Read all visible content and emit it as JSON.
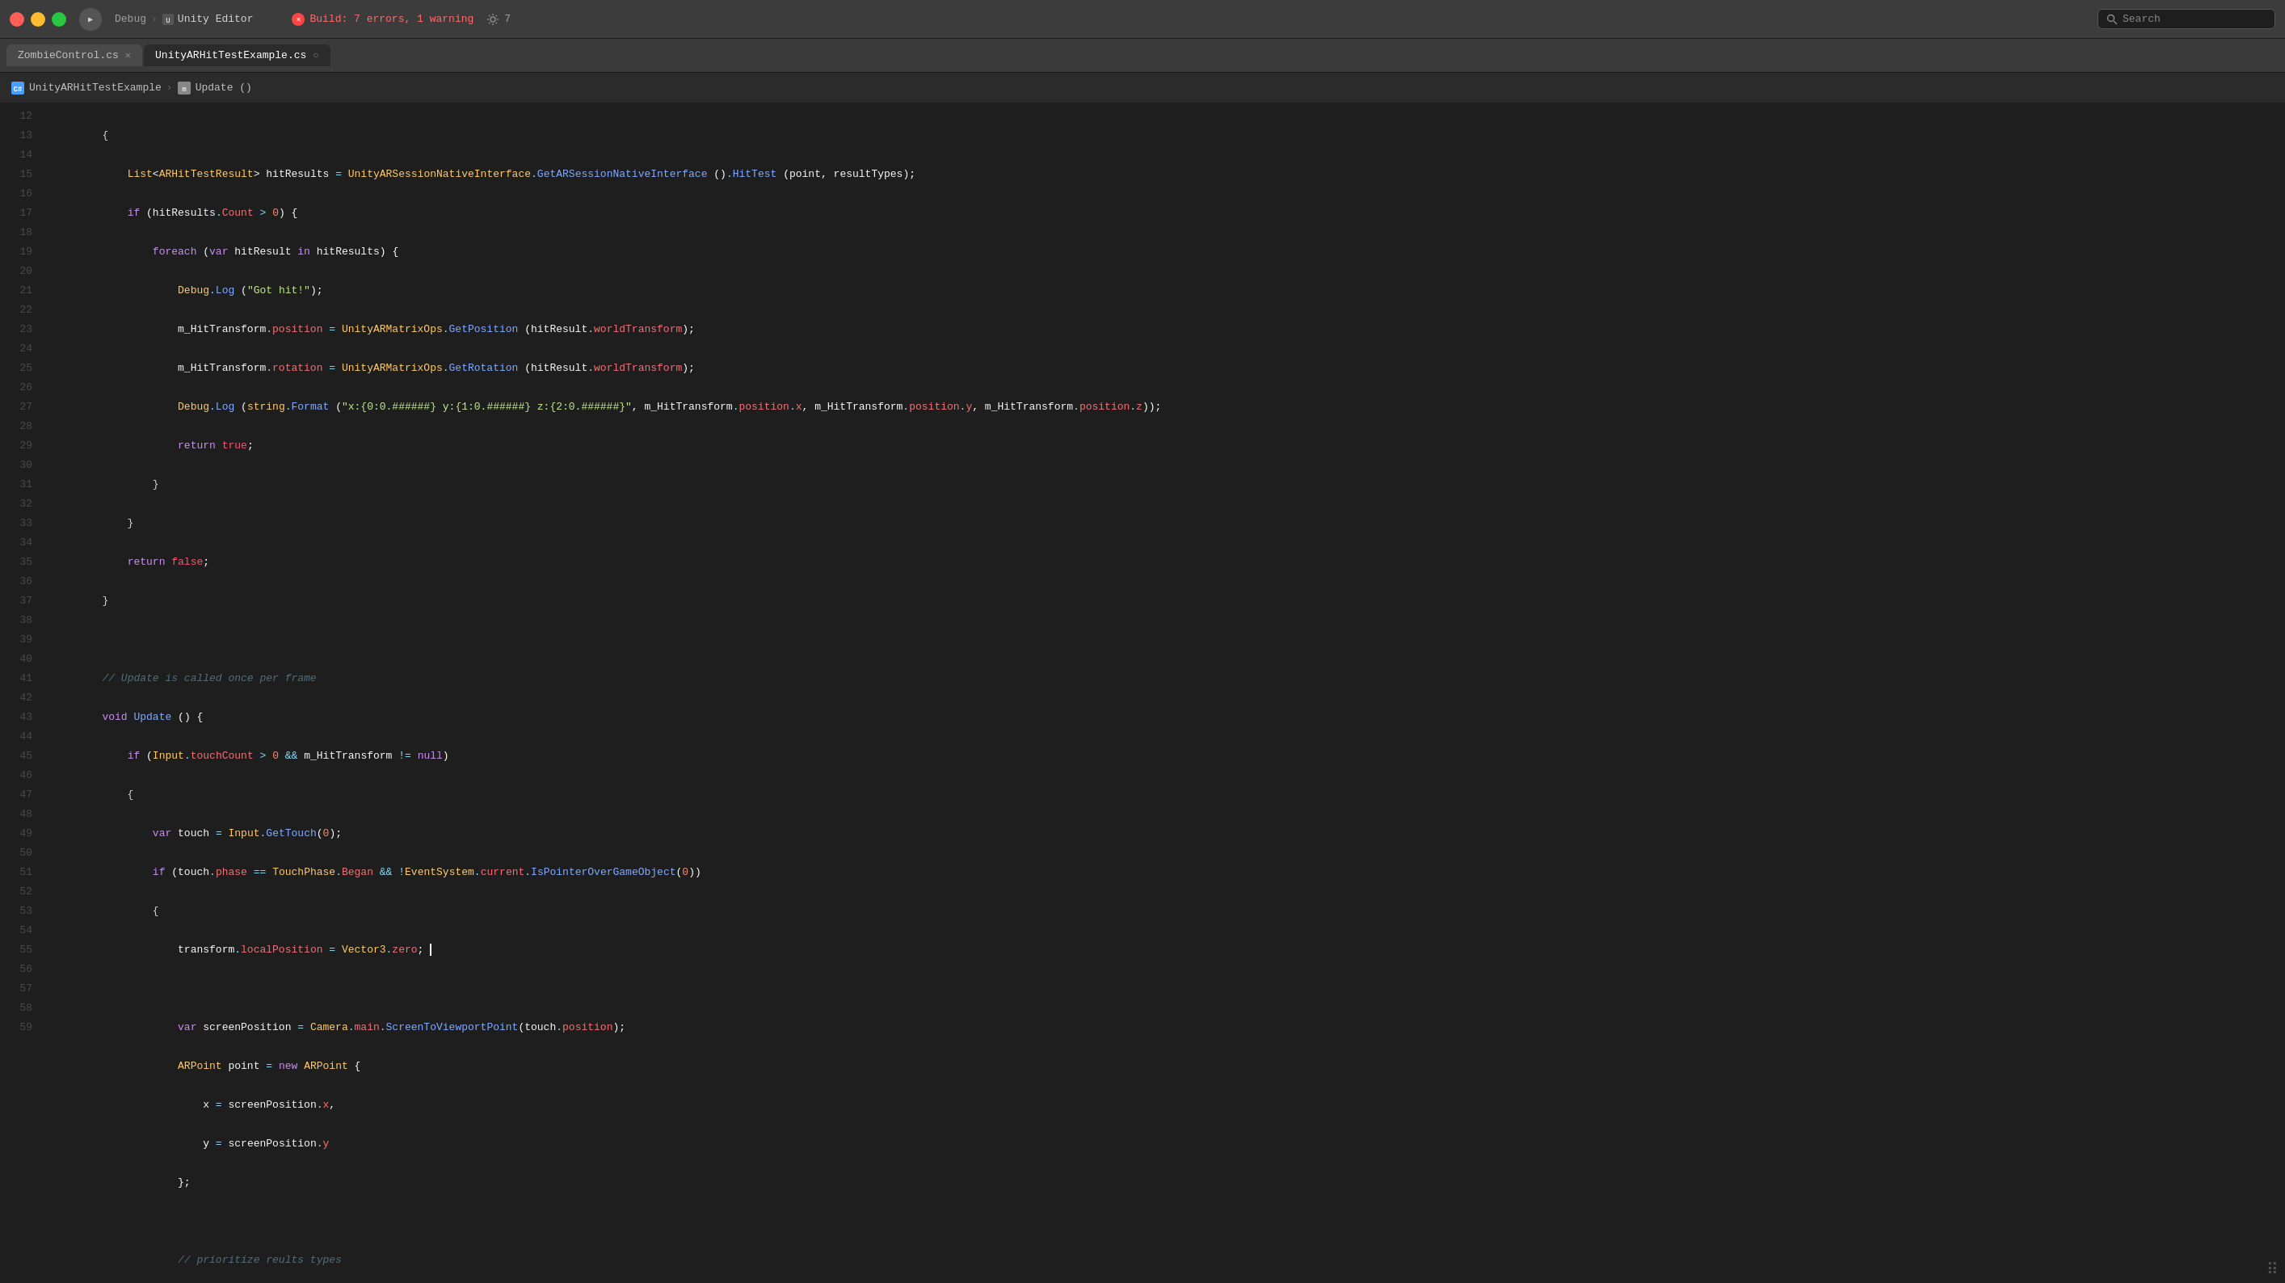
{
  "titlebar": {
    "nav": {
      "debug_label": "Debug",
      "separator": ">",
      "unity_editor_label": "Unity Editor"
    },
    "build_status": {
      "text": "Build: 7 errors, 1 warning",
      "count": "7"
    },
    "search_placeholder": "Search"
  },
  "tabs": [
    {
      "label": "ZombieControl.cs",
      "active": false
    },
    {
      "label": "UnityARHitTestExample.cs",
      "active": true
    }
  ],
  "breadcrumb": {
    "class": "UnityARHitTestExample",
    "method": "Update ()"
  },
  "lines": [
    {
      "num": "12",
      "indent": 2,
      "content": "{"
    },
    {
      "num": "13",
      "indent": 3
    },
    {
      "num": "14",
      "indent": 3
    },
    {
      "num": "15",
      "indent": 4
    },
    {
      "num": "16",
      "indent": 5
    },
    {
      "num": "17",
      "indent": 5
    },
    {
      "num": "18",
      "indent": 5
    },
    {
      "num": "19",
      "indent": 5
    },
    {
      "num": "20",
      "indent": 5
    },
    {
      "num": "21",
      "indent": 4,
      "content": "}"
    },
    {
      "num": "22",
      "indent": 3
    },
    {
      "num": "23",
      "indent": 3
    },
    {
      "num": "24",
      "indent": 2,
      "content": "}"
    },
    {
      "num": "25",
      "indent": 0,
      "content": ""
    },
    {
      "num": "26",
      "indent": 2
    },
    {
      "num": "27",
      "indent": 2
    },
    {
      "num": "28",
      "indent": 3
    },
    {
      "num": "29",
      "indent": 3,
      "content": "{"
    },
    {
      "num": "30",
      "indent": 4
    },
    {
      "num": "31",
      "indent": 4
    },
    {
      "num": "32",
      "indent": 4,
      "content": "{"
    },
    {
      "num": "33",
      "indent": 5
    },
    {
      "num": "34",
      "indent": 0,
      "content": ""
    },
    {
      "num": "35",
      "indent": 5
    },
    {
      "num": "36",
      "indent": 5
    },
    {
      "num": "37",
      "indent": 6
    },
    {
      "num": "38",
      "indent": 6
    },
    {
      "num": "39",
      "indent": 5,
      "content": "};"
    },
    {
      "num": "40",
      "indent": 0,
      "content": ""
    },
    {
      "num": "41",
      "indent": 5
    },
    {
      "num": "42",
      "indent": 5
    },
    {
      "num": "43",
      "indent": 6
    },
    {
      "num": "44",
      "indent": 6
    },
    {
      "num": "45",
      "indent": 6
    },
    {
      "num": "46",
      "indent": 6
    },
    {
      "num": "47",
      "indent": 6
    },
    {
      "num": "48",
      "indent": 5,
      "content": "};"
    },
    {
      "num": "49",
      "indent": 0,
      "content": ""
    },
    {
      "num": "50",
      "indent": 5
    },
    {
      "num": "51",
      "indent": 5,
      "content": "{"
    },
    {
      "num": "52",
      "indent": 6
    },
    {
      "num": "53",
      "indent": 6,
      "content": "{"
    },
    {
      "num": "54",
      "indent": 7
    },
    {
      "num": "55",
      "indent": 6,
      "content": "}"
    },
    {
      "num": "56",
      "indent": 0,
      "content": ""
    },
    {
      "num": "57",
      "indent": 4,
      "content": "}"
    },
    {
      "num": "58",
      "indent": 3,
      "content": "}"
    },
    {
      "num": "59",
      "indent": 2,
      "content": "{"
    }
  ]
}
